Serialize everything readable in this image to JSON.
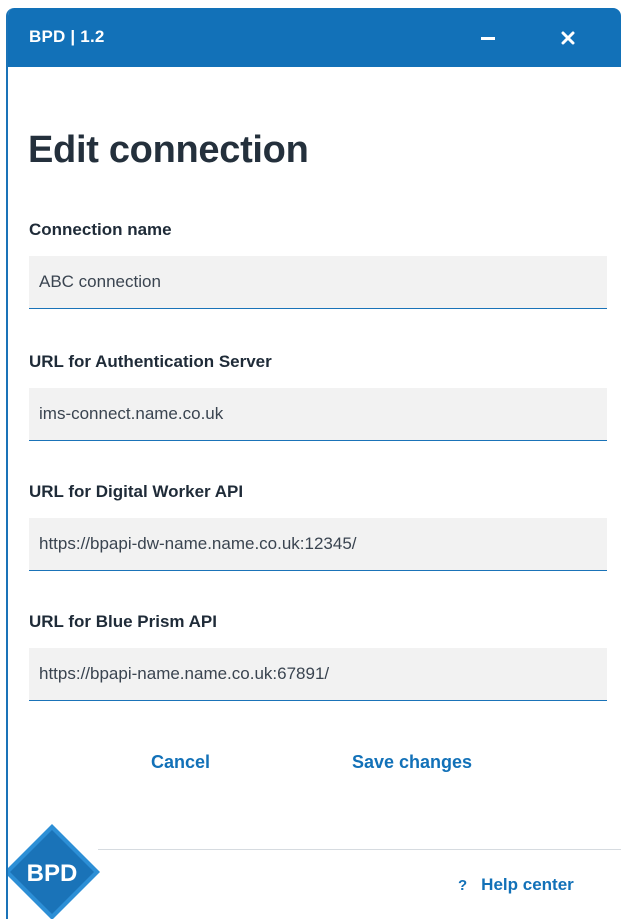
{
  "window": {
    "title": "BPD | 1.2"
  },
  "page": {
    "title": "Edit connection"
  },
  "fields": [
    {
      "label": "Connection name",
      "value": "ABC connection"
    },
    {
      "label": "URL for Authentication Server",
      "value": "ims-connect.name.co.uk"
    },
    {
      "label": "URL for Digital Worker API",
      "value": "https://bpapi-dw-name.name.co.uk:12345/"
    },
    {
      "label": "URL for Blue Prism API",
      "value": "https://bpapi-name.name.co.uk:67891/"
    }
  ],
  "actions": {
    "cancel_label": "Cancel",
    "save_label": "Save changes"
  },
  "footer": {
    "logo_text": "BPD",
    "help_icon": "?",
    "help_label": "Help center"
  },
  "icons": {
    "minimize": "minimize-icon",
    "close": "close-icon",
    "help": "question-mark-icon",
    "logo": "bpd-logo"
  },
  "colors": {
    "titlebar": "#1271b8",
    "accent": "#1271b8",
    "input_bg": "#f2f2f2",
    "text": "#1f2b38"
  }
}
